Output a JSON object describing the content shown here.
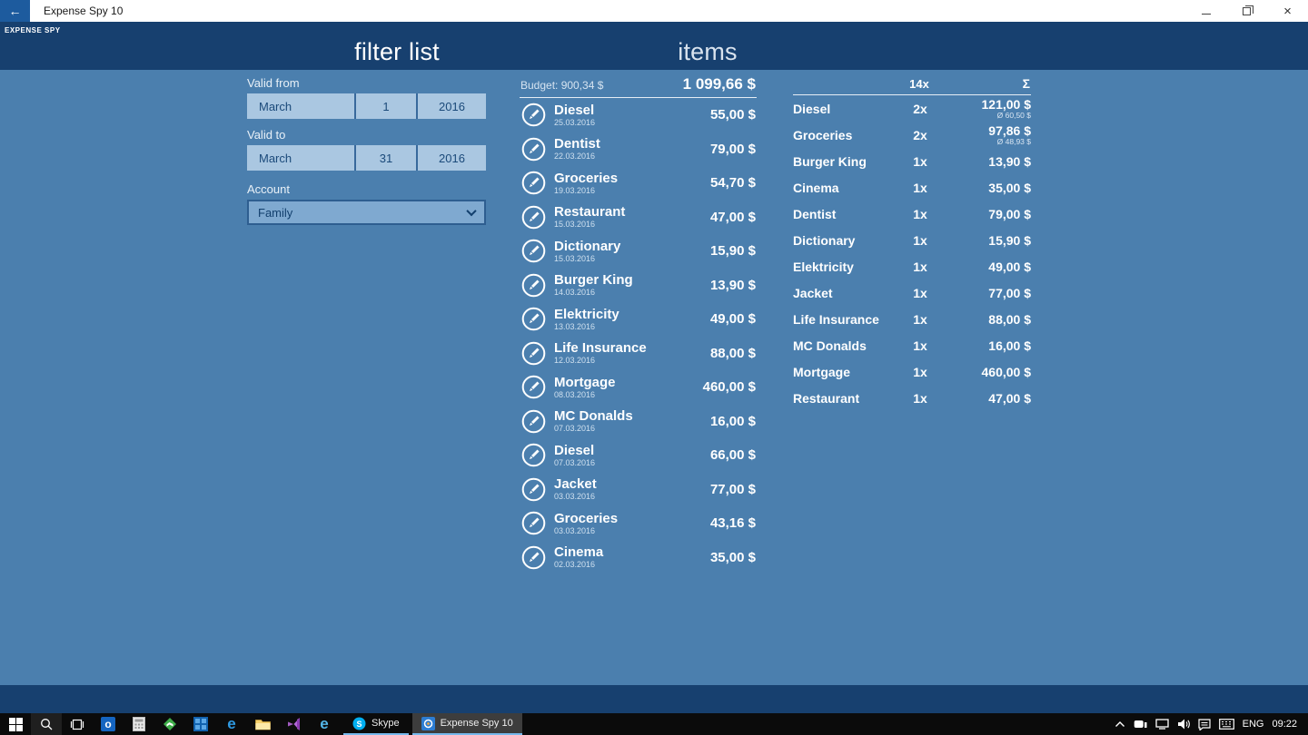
{
  "colors": {
    "header_navy": "#17406f",
    "content_blue": "#4b7fae",
    "picker_light": "#aac7e1",
    "back_accent": "#1d5b9e",
    "taskbar_underline": "#76b9ed"
  },
  "titlebar": {
    "title": "Expense Spy 10",
    "back_icon": "←"
  },
  "header": {
    "app_label": "EXPENSE SPY",
    "pivot_filter": "filter list",
    "pivot_items": "items"
  },
  "filter": {
    "valid_from": {
      "label": "Valid from",
      "month": "March",
      "day": "1",
      "year": "2016"
    },
    "valid_to": {
      "label": "Valid to",
      "month": "March",
      "day": "31",
      "year": "2016"
    },
    "account": {
      "label": "Account",
      "value": "Family"
    }
  },
  "items": {
    "budget_label": "Budget: 900,34 $",
    "total": "1 099,66 $",
    "list": [
      {
        "name": "Diesel",
        "date": "25.03.2016",
        "amount": "55,00 $"
      },
      {
        "name": "Dentist",
        "date": "22.03.2016",
        "amount": "79,00 $"
      },
      {
        "name": "Groceries",
        "date": "19.03.2016",
        "amount": "54,70 $"
      },
      {
        "name": "Restaurant",
        "date": "15.03.2016",
        "amount": "47,00 $"
      },
      {
        "name": "Dictionary",
        "date": "15.03.2016",
        "amount": "15,90 $"
      },
      {
        "name": "Burger King",
        "date": "14.03.2016",
        "amount": "13,90 $"
      },
      {
        "name": "Elektricity",
        "date": "13.03.2016",
        "amount": "49,00 $"
      },
      {
        "name": "Life Insurance",
        "date": "12.03.2016",
        "amount": "88,00 $"
      },
      {
        "name": "Mortgage",
        "date": "08.03.2016",
        "amount": "460,00 $"
      },
      {
        "name": "MC Donalds",
        "date": "07.03.2016",
        "amount": "16,00 $"
      },
      {
        "name": "Diesel",
        "date": "07.03.2016",
        "amount": "66,00 $"
      },
      {
        "name": "Jacket",
        "date": "03.03.2016",
        "amount": "77,00 $"
      },
      {
        "name": "Groceries",
        "date": "03.03.2016",
        "amount": "43,16 $"
      },
      {
        "name": "Cinema",
        "date": "02.03.2016",
        "amount": "35,00 $"
      }
    ]
  },
  "summary": {
    "count_header": "14x",
    "sum_header": "Σ",
    "rows": [
      {
        "name": "Diesel",
        "count": "2x",
        "sum": "121,00 $",
        "avg": "Ø 60,50 $"
      },
      {
        "name": "Groceries",
        "count": "2x",
        "sum": "97,86 $",
        "avg": "Ø 48,93 $"
      },
      {
        "name": "Burger King",
        "count": "1x",
        "sum": "13,90 $"
      },
      {
        "name": "Cinema",
        "count": "1x",
        "sum": "35,00 $"
      },
      {
        "name": "Dentist",
        "count": "1x",
        "sum": "79,00 $"
      },
      {
        "name": "Dictionary",
        "count": "1x",
        "sum": "15,90 $"
      },
      {
        "name": "Elektricity",
        "count": "1x",
        "sum": "49,00 $"
      },
      {
        "name": "Jacket",
        "count": "1x",
        "sum": "77,00 $"
      },
      {
        "name": "Life Insurance",
        "count": "1x",
        "sum": "88,00 $"
      },
      {
        "name": "MC Donalds",
        "count": "1x",
        "sum": "16,00 $"
      },
      {
        "name": "Mortgage",
        "count": "1x",
        "sum": "460,00 $"
      },
      {
        "name": "Restaurant",
        "count": "1x",
        "sum": "47,00 $"
      }
    ]
  },
  "taskbar": {
    "skype_label": "Skype",
    "active_app_label": "Expense Spy 10",
    "language": "ENG",
    "time": "09:22",
    "app_icon_names": [
      "start",
      "search",
      "task-view",
      "outlook",
      "calculator",
      "money-app",
      "photos",
      "edge",
      "file-explorer",
      "visual-studio",
      "internet-explorer"
    ],
    "tray_icon_names": [
      "chevron-up",
      "device",
      "network",
      "volume",
      "action-center",
      "touch-keyboard"
    ]
  }
}
